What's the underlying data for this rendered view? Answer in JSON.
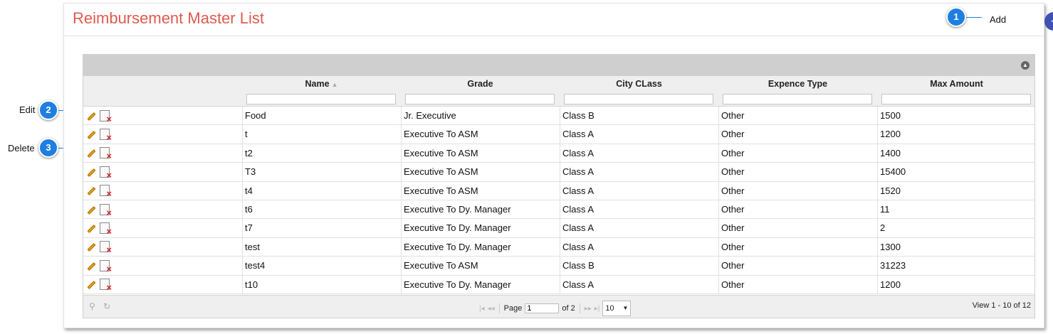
{
  "page": {
    "title": "Reimbursement Master List"
  },
  "header": {
    "add_label": "Add",
    "add_button": "+",
    "help_button": "?"
  },
  "callouts": [
    {
      "number": "1",
      "label": "Add"
    },
    {
      "number": "2",
      "label": "Edit"
    },
    {
      "number": "3",
      "label": "Delete"
    }
  ],
  "grid": {
    "columns": [
      "Name",
      "Grade",
      "City CLass",
      "Expence Type",
      "Max Amount"
    ],
    "rows": [
      [
        "Food",
        "Jr. Executive",
        "Class B",
        "Other",
        "1500"
      ],
      [
        "t",
        "Executive To ASM",
        "Class A",
        "Other",
        "1200"
      ],
      [
        "t2",
        "Executive To ASM",
        "Class A",
        "Other",
        "1400"
      ],
      [
        "T3",
        "Executive To ASM",
        "Class A",
        "Other",
        "15400"
      ],
      [
        "t4",
        "Executive To ASM",
        "Class A",
        "Other",
        "1520"
      ],
      [
        "t6",
        "Executive To Dy. Manager",
        "Class A",
        "Other",
        "11"
      ],
      [
        "t7",
        "Executive To Dy. Manager",
        "Class A",
        "Other",
        "2"
      ],
      [
        "test",
        "Executive To Dy. Manager",
        "Class A",
        "Other",
        "1300"
      ],
      [
        "test4",
        "Executive To ASM",
        "Class B",
        "Other",
        "31223"
      ],
      [
        "t10",
        "Executive To Dy. Manager",
        "Class A",
        "Other",
        "1200"
      ]
    ]
  },
  "pager": {
    "page_label": "Page",
    "page_value": "1",
    "of_label": "of 2",
    "page_size": "10",
    "view_text": "View 1 - 10 of 12"
  },
  "colors": {
    "title": "#e05a4f",
    "callout": "#1e7fe0",
    "add_button": "#3f51b5",
    "help_button": "#f7941d"
  }
}
